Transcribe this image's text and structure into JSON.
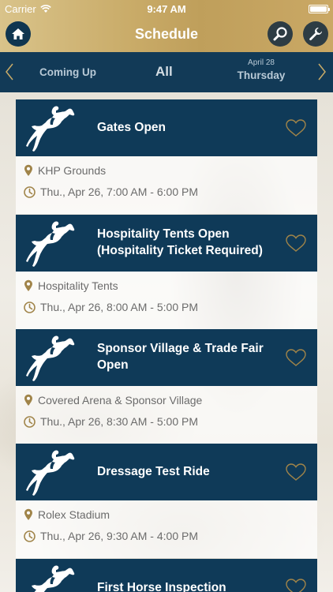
{
  "status_bar": {
    "carrier": "Carrier",
    "time": "9:47 AM"
  },
  "header": {
    "title": "Schedule"
  },
  "tabs": {
    "coming_up": "Coming Up",
    "all": "All",
    "date_small": "April 28",
    "date_day": "Thursday"
  },
  "colors": {
    "header_gold": "#c9ab68",
    "navy": "#0f3a58",
    "tabbar": "#123a57",
    "accent_gold": "#a08449"
  },
  "events": [
    {
      "title": "Gates Open",
      "location": "KHP Grounds",
      "time": "Thu., Apr 26, 7:00 AM - 6:00 PM",
      "icon": "horse-jumping-icon",
      "favorite": false
    },
    {
      "title": "Hospitality Tents Open (Hospitality Ticket Required)",
      "location": "Hospitality Tents",
      "time": "Thu., Apr 26, 8:00 AM - 5:00 PM",
      "icon": "horse-jumping-icon",
      "favorite": false
    },
    {
      "title": "Sponsor Village & Trade Fair Open",
      "location": "Covered Arena & Sponsor Village",
      "time": "Thu., Apr 26, 8:30 AM - 5:00 PM",
      "icon": "horse-jumping-icon",
      "favorite": false
    },
    {
      "title": "Dressage Test Ride",
      "location": "Rolex Stadium",
      "time": "Thu., Apr 26, 9:30 AM - 4:00 PM",
      "icon": "horse-jumping-icon",
      "favorite": false
    },
    {
      "title": "First Horse Inspection",
      "location": "",
      "time": "",
      "icon": "horse-jumping-icon",
      "favorite": false
    }
  ]
}
